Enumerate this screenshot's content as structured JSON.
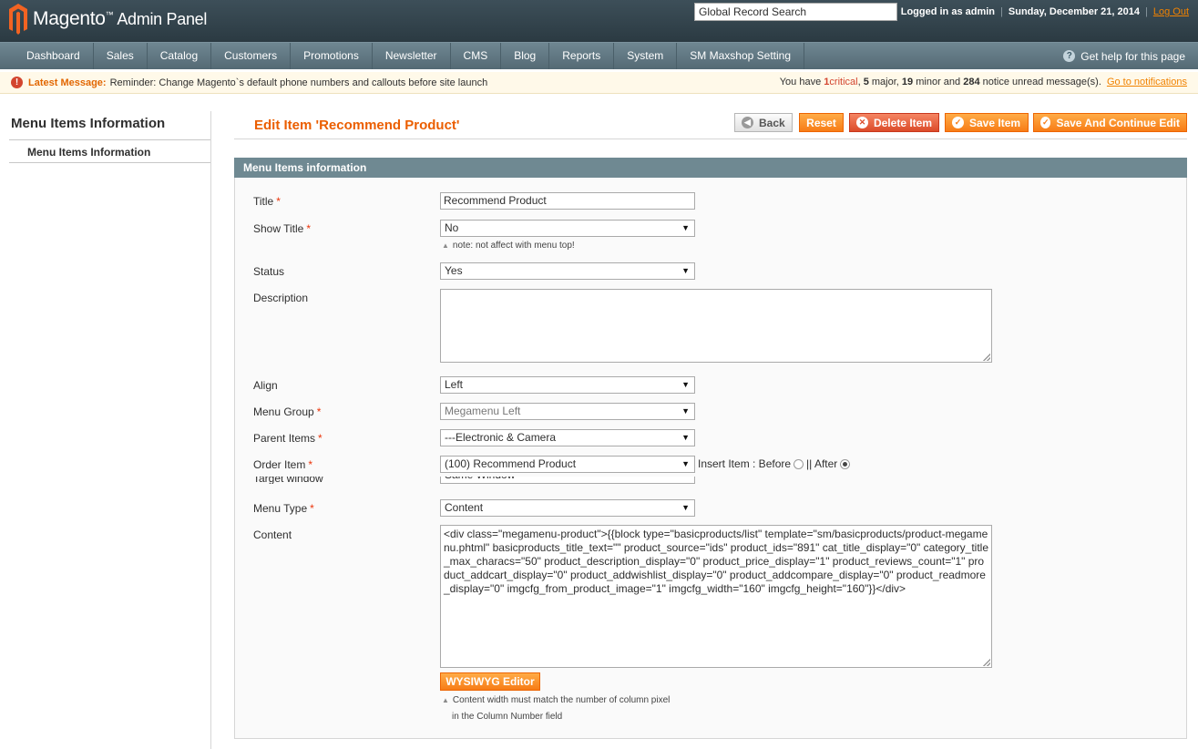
{
  "header": {
    "logo_brand": "Magento",
    "logo_tm": "™",
    "logo_suffix": "Admin Panel",
    "search_value": "Global Record Search",
    "logged_in": "Logged in as admin",
    "date": "Sunday, December 21, 2014",
    "logout": "Log Out"
  },
  "nav": {
    "items": [
      "Dashboard",
      "Sales",
      "Catalog",
      "Customers",
      "Promotions",
      "Newsletter",
      "CMS",
      "Blog",
      "Reports",
      "System",
      "SM Maxshop Setting"
    ],
    "help": "Get help for this page"
  },
  "notice": {
    "label": "Latest Message:",
    "message": "Reminder: Change Magento`s default phone numbers and callouts before site launch",
    "summary_prefix": "You have",
    "critical_count": "1",
    "critical_label": "critical",
    "major_count": "5",
    "major_label": "major,",
    "minor_count": "19",
    "minor_label": "minor and",
    "notice_count": "284",
    "notice_label": "notice unread message(s).",
    "goto": "Go to notifications"
  },
  "sidebar": {
    "title": "Menu Items Information",
    "tab": "Menu Items Information"
  },
  "page": {
    "title": "Edit Item 'Recommend Product'",
    "buttons": {
      "back": "Back",
      "reset": "Reset",
      "delete": "Delete Item",
      "save": "Save Item",
      "save_continue": "Save And Continue Edit"
    }
  },
  "form": {
    "section_title": "Menu Items information",
    "title_label": "Title",
    "title_value": "Recommend Product",
    "show_title_label": "Show Title",
    "show_title_value": "No",
    "show_title_note": "note: not affect with menu top!",
    "status_label": "Status",
    "status_value": "Yes",
    "description_label": "Description",
    "description_value": "",
    "align_label": "Align",
    "align_value": "Left",
    "menu_group_label": "Menu Group",
    "menu_group_value": "Megamenu Left",
    "parent_items_label": "Parent Items",
    "parent_items_value": "---Electronic & Camera",
    "order_item_label": "Order Item",
    "order_item_value": "(100) Recommend Product",
    "insert_item_label": "Insert Item : Before",
    "insert_item_after": "|| After",
    "target_window_label": "Target window",
    "target_window_value": "Same Window",
    "menu_type_label": "Menu Type",
    "menu_type_value": "Content",
    "content_label": "Content",
    "content_value": "<div class=\"megamenu-product\">{{block type=\"basicproducts/list\" template=\"sm/basicproducts/product-megamenu.phtml\" basicproducts_title_text=\"\" product_source=\"ids\" product_ids=\"891\" cat_title_display=\"0\" category_title_max_characs=\"50\" product_description_display=\"0\" product_price_display=\"1\" product_reviews_count=\"1\" product_addcart_display=\"0\" product_addwishlist_display=\"0\" product_addcompare_display=\"0\" product_readmore_display=\"0\" imgcfg_from_product_image=\"1\" imgcfg_width=\"160\" imgcfg_height=\"160\"}}</div>",
    "wysiwyg_button": "WYSIWYG Editor",
    "content_note_line1": "Content width must match the number of column pixel",
    "content_note_line2": "in the Column Number field"
  },
  "colors": {
    "accent_orange": "#eb5e00",
    "header_bg": "#2b3a42",
    "nav_bg": "#546a74",
    "required": "#eb340a"
  }
}
